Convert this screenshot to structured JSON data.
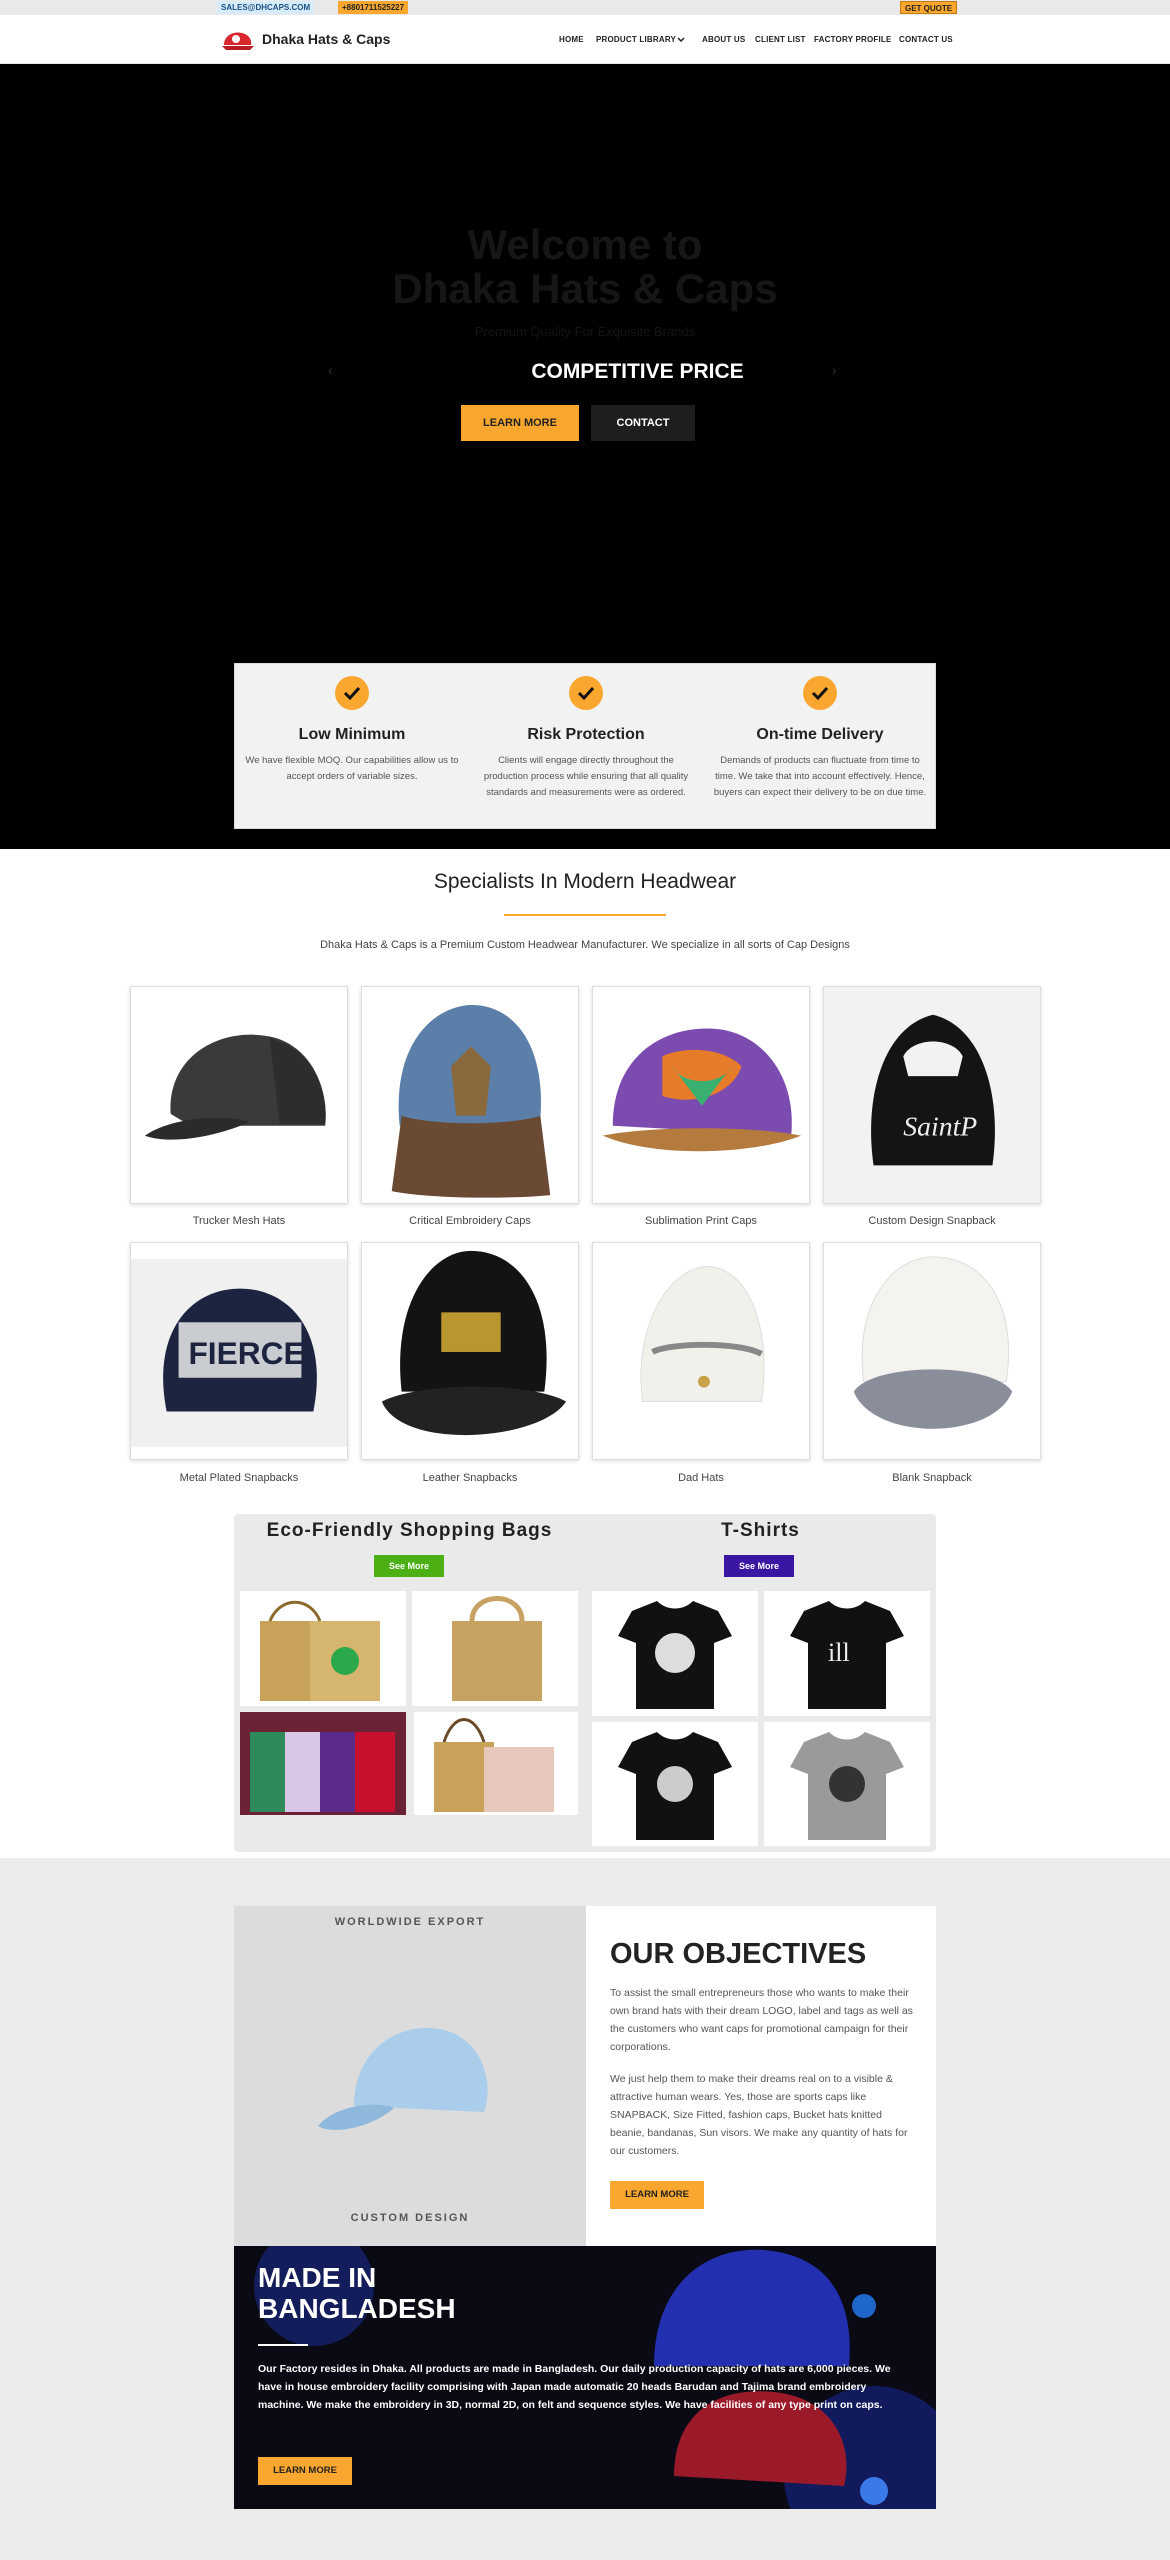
{
  "topbar": {
    "email": "SALES@DHCAPS.COM",
    "phone": "+8801711525227",
    "quote_label": "GET QUOTE"
  },
  "header": {
    "brand": "Dhaka Hats & Caps",
    "nav": [
      "HOME",
      "PRODUCT LIBRARY",
      "ABOUT US",
      "CLIENT LIST",
      "FACTORY PROFILE",
      "CONTACT US"
    ]
  },
  "hero": {
    "title_line1": "Welcome to",
    "title_line2": "Dhaka Hats & Caps",
    "subtitle": "Premium Quality For Exquisite Brands",
    "slide_text": "COMPETITIVE PRICE",
    "btn_learn": "LEARN MORE",
    "btn_contact": "CONTACT"
  },
  "features": [
    {
      "title": "Low Minimum",
      "text": "We have flexible MOQ. Our capabilities allow us to accept orders of variable sizes."
    },
    {
      "title": "Risk Protection",
      "text": "Clients will engage directly throughout the production process while ensuring that all quality standards and measurements were as ordered."
    },
    {
      "title": "On-time Delivery",
      "text": "Demands of products can fluctuate from time to time. We take that into account effectively. Hence, buyers can expect their delivery to be on due time."
    }
  ],
  "specialists": {
    "title": "Specialists In Modern Headwear",
    "intro": "Dhaka Hats & Caps is a Premium Custom Headwear Manufacturer. We specialize in all sorts of Cap Designs"
  },
  "products": [
    {
      "label": "Trucker Mesh Hats"
    },
    {
      "label": "Critical Embroidery Caps"
    },
    {
      "label": "Sublimation Print Caps"
    },
    {
      "label": "Custom Design Snapback"
    },
    {
      "label": "Metal Plated Snapbacks"
    },
    {
      "label": "Leather Snapbacks"
    },
    {
      "label": "Dad Hats"
    },
    {
      "label": "Blank Snapback"
    }
  ],
  "extras": {
    "bags_title": "Eco-Friendly Shopping Bags",
    "bags_btn": "See More",
    "tshirts_title": "T-Shirts",
    "tshirts_btn": "See More"
  },
  "export": {
    "top_label": "WORLDWIDE EXPORT",
    "bottom_label": "CUSTOM DESIGN"
  },
  "objectives": {
    "title": "OUR OBJECTIVES",
    "p1": "To assist the small entrepreneurs those who wants to make their own brand hats with their dream LOGO, label and tags as well as the customers who want caps for promotional campaign for their corporations.",
    "p2": "We just help them to make their dreams real on to a visible & attractive human wears. Yes, those are sports caps like SNAPBACK, Size Fitted, fashion caps, Bucket hats knitted beanie, bandanas, Sun visors. We make any quantity of hats for our customers.",
    "btn": "LEARN MORE"
  },
  "made_in": {
    "title_line1": "MADE IN",
    "title_line2": "BANGLADESH",
    "text": "Our Factory resides in Dhaka. All products are made in Bangladesh. Our daily production capacity of hats are 6,000 pieces. We have in house embroidery facility comprising with Japan made automatic 20 heads Barudan and Tajima brand embroidery machine. We make the embroidery in 3D, normal 2D, on felt and sequence styles. We have facilities of any type print on caps.",
    "btn": "LEARN MORE"
  },
  "colors": {
    "accent": "#f9a72f",
    "green": "#4caf14",
    "purple": "#3b16a3"
  }
}
